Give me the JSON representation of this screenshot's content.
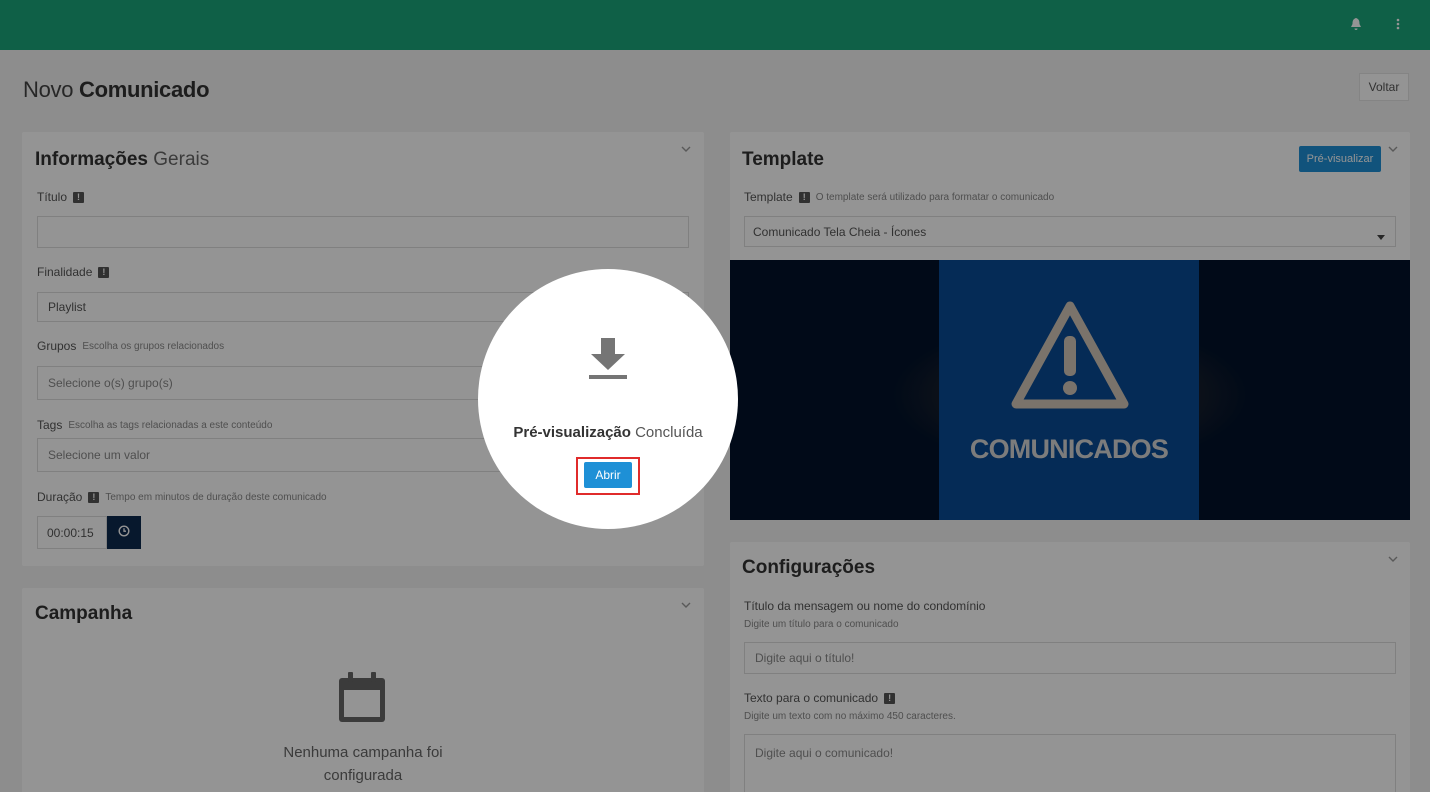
{
  "header": {
    "notification_icon": "bell-icon",
    "menu_icon": "kebab-menu-icon"
  },
  "page": {
    "title_light": "Novo",
    "title_bold": "Comunicado",
    "back_label": "Voltar"
  },
  "info": {
    "title_bold": "Informações",
    "title_light": "Gerais",
    "titulo_label": "Título",
    "titulo_value": "",
    "finalidade_label": "Finalidade",
    "finalidade_value": "Playlist",
    "grupos_label": "Grupos",
    "grupos_help": "Escolha os grupos relacionados",
    "grupos_placeholder": "Selecione o(s) grupo(s)",
    "tags_label": "Tags",
    "tags_help": "Escolha as tags relacionadas a este conteúdo",
    "tags_placeholder": "Selecione um valor",
    "duracao_label": "Duração",
    "duracao_help": "Tempo em minutos de duração deste comunicado",
    "duracao_value": "00:00:15"
  },
  "campaign": {
    "title": "Campanha",
    "empty_text_line1": "Nenhuma campanha foi",
    "empty_text_line2": "configurada"
  },
  "template": {
    "title": "Template",
    "preview_button": "Pré-visualizar",
    "label": "Template",
    "help": "O template será utilizado para formatar o comunicado",
    "selected": "Comunicado Tela Cheia - Ícones",
    "preview_text": "COMUNICADOS"
  },
  "config": {
    "title": "Configurações",
    "msg_title_label": "Título da mensagem ou nome do condomínio",
    "msg_title_help": "Digite um título para o comunicado",
    "msg_title_placeholder": "Digite aqui o título!",
    "text_label": "Texto para o comunicado",
    "text_help": "Digite um texto com no máximo 450 caracteres.",
    "text_placeholder": "Digite aqui o comunicado!"
  },
  "spotlight": {
    "title_bold": "Pré-visualização",
    "title_light": "Concluída",
    "button": "Abrir"
  },
  "colors": {
    "topbar": "#1aa57a",
    "primary": "#1e90d6",
    "highlight": "#e02b2b"
  }
}
